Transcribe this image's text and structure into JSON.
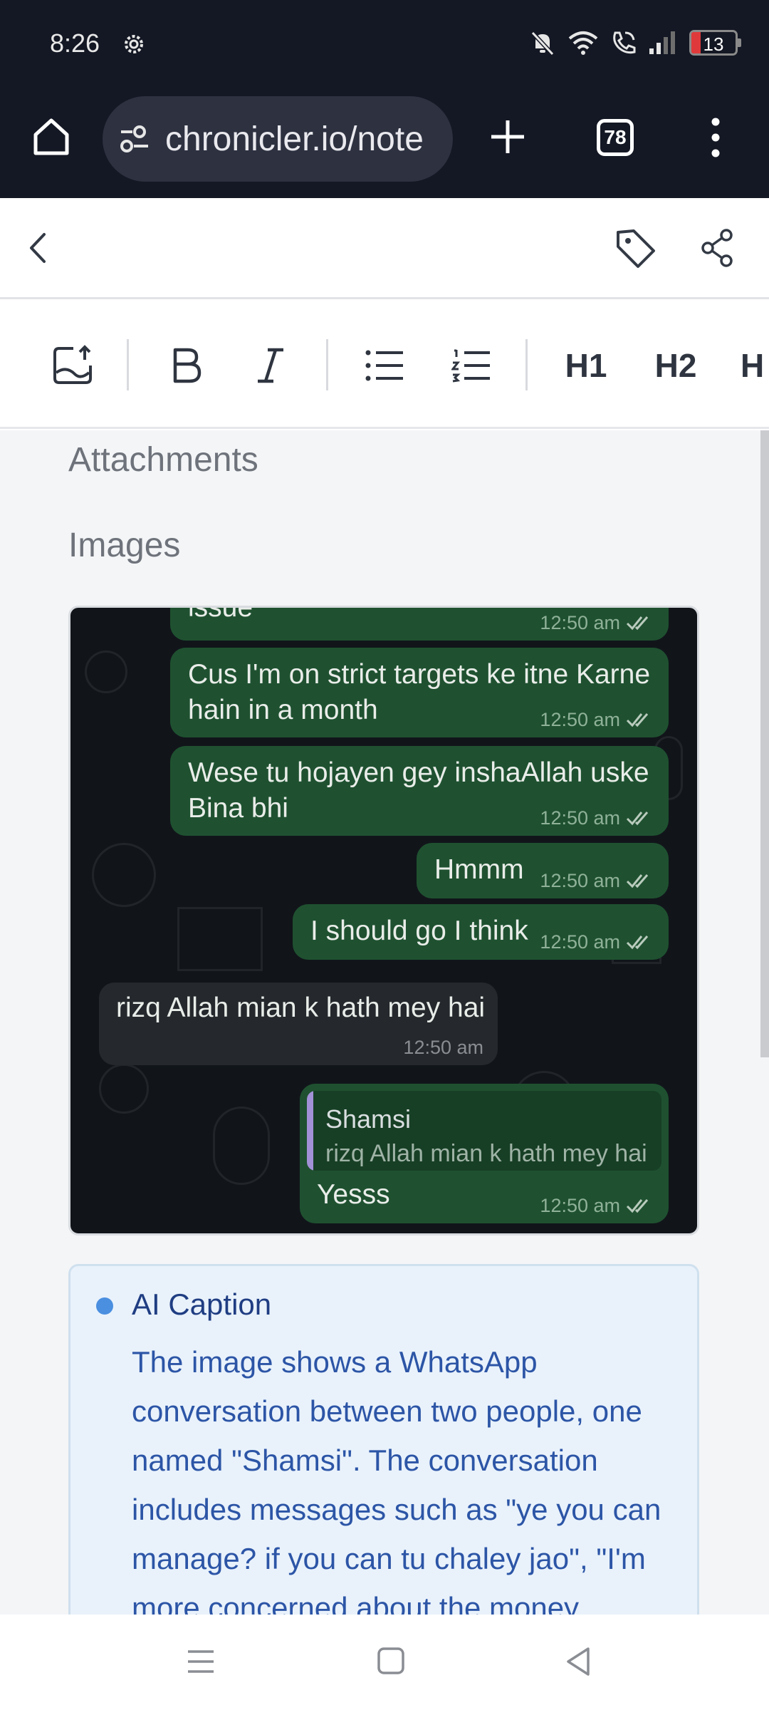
{
  "status_bar": {
    "time": "8:26",
    "battery_level": "13",
    "icons": [
      "settings-gear-icon",
      "mute-bell-icon",
      "wifi-icon",
      "wifi-call-icon",
      "signal-icon",
      "battery-icon"
    ]
  },
  "browser": {
    "url": "chronicler.io/note",
    "tab_count": "78"
  },
  "toolbar": {
    "h1_label": "H1",
    "h2_label": "H2",
    "h3_label": "H"
  },
  "content": {
    "attachments_heading": "Attachments",
    "images_heading": "Images"
  },
  "chat_screenshot": {
    "messages": [
      {
        "text": "issue",
        "time": "12:50 am",
        "direction": "out"
      },
      {
        "text_line1": "Cus I'm on strict targets ke itne Karne",
        "text_line2": "hain in a month",
        "time": "12:50 am",
        "direction": "out"
      },
      {
        "text_line1": "Wese tu hojayen gey inshaAllah uske",
        "text_line2": "Bina bhi",
        "time": "12:50 am",
        "direction": "out"
      },
      {
        "text": "Hmmm",
        "time": "12:50 am",
        "direction": "out"
      },
      {
        "text": "I should go I think",
        "time": "12:50 am",
        "direction": "out"
      },
      {
        "text": "rizq Allah mian k hath mey hai",
        "time": "12:50 am",
        "direction": "in"
      },
      {
        "quote_name": "Shamsi",
        "quote_text": "rizq Allah mian k hath mey hai",
        "text": "Yesss",
        "time": "12:50 am",
        "direction": "out"
      }
    ]
  },
  "ai_caption": {
    "title": "AI Caption",
    "text": "The image shows a WhatsApp conversation between two people, one named \"Shamsi\". The conversation includes messages such as \"ye you can manage? if you can tu chaley jao\", \"I'm more concerned about the money"
  },
  "colors": {
    "status_bar_bg": "#141824",
    "url_pill_bg": "#2d3140",
    "outgoing_bubble": "#1f5130",
    "incoming_bubble": "#25282c",
    "caption_bg": "#e9f2fb",
    "caption_text": "#2c55a6",
    "caption_dot": "#4a8fe0"
  }
}
